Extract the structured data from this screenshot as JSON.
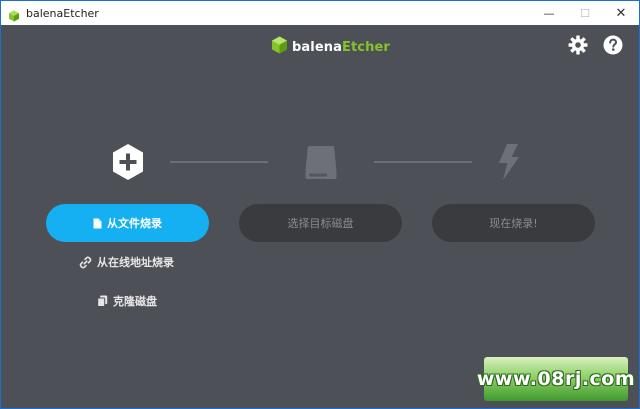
{
  "window": {
    "title": "balenaEtcher",
    "controls": {
      "minimize": "—",
      "maximize": "☐",
      "close": "✕"
    }
  },
  "header": {
    "logo_part1": "balena",
    "logo_part2": "Etcher"
  },
  "steps": {
    "flash_from_file": "从文件烧录",
    "select_target": "选择目标磁盘",
    "flash_now": "现在烧录!"
  },
  "options": {
    "flash_from_url": "从在线地址烧录",
    "clone_drive": "克隆磁盘"
  },
  "watermark": {
    "text": "www.08rj.com"
  },
  "colors": {
    "background": "#4d5057",
    "accent": "#14b0f2",
    "brand_green": "#85c427",
    "disabled_button": "#3a3b3f"
  },
  "icons": {
    "app": "balena-cube-icon",
    "settings": "gear-icon",
    "help": "help-icon",
    "step1": "plus-hexagon-icon",
    "step2": "drive-icon",
    "step3": "lightning-icon"
  }
}
